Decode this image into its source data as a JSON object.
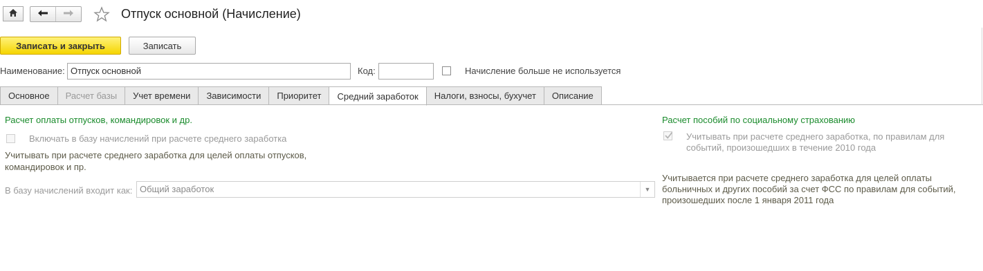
{
  "window": {
    "title": "Отпуск основной (Начисление)",
    "icons": {
      "home": "home-icon",
      "back": "arrow-left-icon",
      "forward": "arrow-right-icon",
      "favorite": "star-icon"
    }
  },
  "toolbar": {
    "save_close_label": "Записать и закрыть",
    "save_label": "Записать"
  },
  "form": {
    "name_label": "Наименование:",
    "name_value": "Отпуск основной",
    "code_label": "Код:",
    "code_value": "",
    "unused_label": "Начисление больше не используется",
    "unused_checked": false
  },
  "tabs": [
    {
      "label": "Основное",
      "state": "normal"
    },
    {
      "label": "Расчет базы",
      "state": "disabled"
    },
    {
      "label": "Учет времени",
      "state": "normal"
    },
    {
      "label": "Зависимости",
      "state": "normal"
    },
    {
      "label": "Приоритет",
      "state": "normal"
    },
    {
      "label": "Средний заработок",
      "state": "active"
    },
    {
      "label": "Налоги, взносы, бухучет",
      "state": "normal"
    },
    {
      "label": "Описание",
      "state": "normal"
    }
  ],
  "left": {
    "heading": "Расчет оплаты отпусков, командировок и др.",
    "include_label": "Включать в базу начислений при расчете среднего заработка",
    "include_checked": false,
    "note_line1": "Учитывать при расчете среднего заработка для целей оплаты отпусков,",
    "note_line2": "командировок и пр.",
    "base_label": "В базу начислений входит как:",
    "base_value": "Общий заработок"
  },
  "right": {
    "heading": "Расчет пособий по социальному страхованию",
    "check_line1": "Учитывать при расчете среднего заработка, по правилам для",
    "check_line2": "событий, произошедших в течение 2010 года",
    "check_checked": true,
    "note_line1": "Учитывается при расчете среднего заработка для целей оплаты",
    "note_line2": "больничных и других пособий за счет ФСС по правилам для событий,",
    "note_line3": "произошедших после 1 января 2011 года"
  },
  "colors": {
    "primary_button": "#f5d500",
    "heading_green": "#1a8b2c",
    "note_text": "#5c5a48",
    "tab_bg": "#e9e9e9"
  }
}
